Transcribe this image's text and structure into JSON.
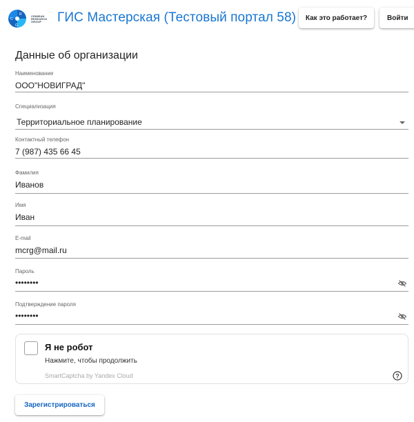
{
  "header": {
    "logo_text": "CRIMEAN RESEARCH GROUP",
    "title": "ГИС Мастерская (Тестовый портал 58)",
    "how_button": "Как это работает?",
    "login_button": "Войти"
  },
  "form": {
    "section_title": "Данные об организации",
    "fields": [
      {
        "label": "Наименование",
        "value": "ООО\"НОВИГРАД\""
      },
      {
        "label": "Специализация",
        "value": "Территориальное планирование"
      },
      {
        "label": "Контактный телефон",
        "value": "7 (987) 435 66 45"
      },
      {
        "label": "Фамилия",
        "value": "Иванов"
      },
      {
        "label": "Имя",
        "value": "Иван"
      },
      {
        "label": "E-mail",
        "value": "mcrg@mail.ru"
      },
      {
        "label": "Пароль",
        "value": "••••••••"
      },
      {
        "label": "Подтверждение пароля",
        "value": "••••••••"
      }
    ]
  },
  "captcha": {
    "title": "Я не робот",
    "subtitle": "Нажмите, чтобы продолжить",
    "brand": "SmartCaptcha by Yandex Cloud",
    "help_symbol": "?"
  },
  "submit_label": "Зарегистрироваться",
  "colors": {
    "accent": "#1976d2",
    "logo_blue": "#1565c0",
    "logo_cyan": "#29b6f6"
  },
  "icons": {
    "password_visibility": "eye-off-icon",
    "select": "caret-down-icon",
    "help": "help-circle-icon"
  }
}
